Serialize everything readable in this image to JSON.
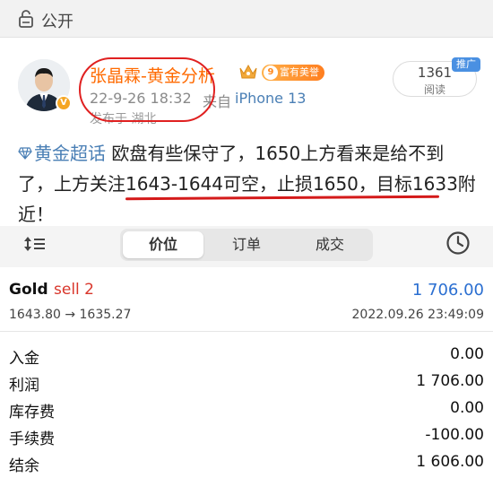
{
  "topbar": {
    "title": "公开",
    "icon": "lock-icon"
  },
  "post": {
    "author": "张晶霖-黄金分析",
    "vip_badge": "V",
    "rich_badge_level": "9",
    "rich_badge_label": "富有美誉",
    "time": "22-9-26 18:32",
    "source_prefix": "来自",
    "source_device": "iPhone 13",
    "location": "发布于 湖北",
    "views": "1361",
    "views_label": "阅读",
    "promo_tag": "推广",
    "topic": "黄金超话",
    "text_part1": " 欧盘有些保守了，1650上方看来是给不到了，",
    "text_part2": "上方关注1643-1644可空，止损1650，目标1633附近",
    "text_part3": "！"
  },
  "toolbar": {
    "tabs": [
      "价位",
      "订单",
      "成交"
    ],
    "active_tab": "价位"
  },
  "trade": {
    "symbol": "Gold",
    "side": "sell 2",
    "profit": "1 706.00",
    "prices": "1643.80 → 1635.27",
    "time": "2022.09.26 23:49:09"
  },
  "summary": [
    {
      "label": "入金",
      "value": "0.00"
    },
    {
      "label": "利润",
      "value": "1 706.00"
    },
    {
      "label": "库存费",
      "value": "0.00"
    },
    {
      "label": "手续费",
      "value": "-100.00"
    },
    {
      "label": "结余",
      "value": "1 606.00"
    }
  ],
  "colors": {
    "accent_orange": "#ff6a00",
    "link_blue": "#4a7fb5",
    "profit_blue": "#2b6fd1",
    "sell_red": "#d9362b",
    "annotation_red": "#d41a1a"
  }
}
